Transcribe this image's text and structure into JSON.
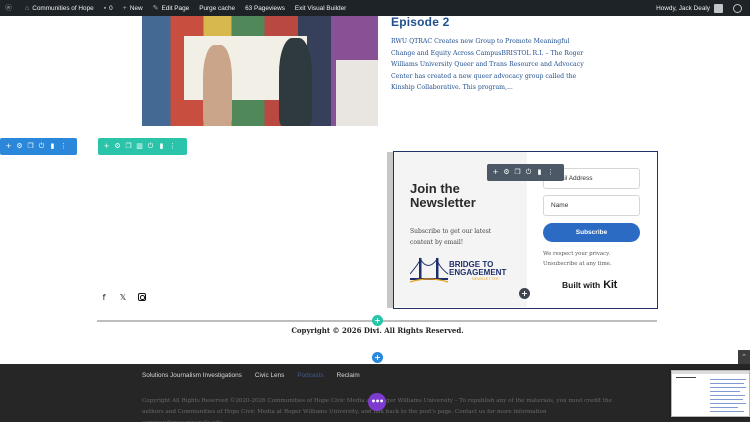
{
  "admin_bar": {
    "wp_logo": "wordpress-icon",
    "site_name": "Communities of Hope",
    "comments_count": "0",
    "new_label": "New",
    "edit_page_label": "Edit Page",
    "purge_cache_label": "Purge cache",
    "pageviews_label": "63 Pageviews",
    "exit_builder_label": "Exit Visual Builder",
    "howdy_label": "Howdy, Jack Dealy"
  },
  "episode": {
    "title": "Episode 2",
    "excerpt": "RWU QTRAC Creates new Group to Promote Meaningful Change and Equity Across CampusBRISTOL R.I. – The Roger Williams University Queer and Trans Resource and Advocacy Center has created a new queer advocacy group called the Kinship Collaborative.  This program,..."
  },
  "toolbars": {
    "row_icons": [
      "add-icon",
      "gear-icon",
      "duplicate-icon",
      "power-icon",
      "trash-icon",
      "more-icon"
    ],
    "section_icons": [
      "add-icon",
      "gear-icon",
      "duplicate-icon",
      "columns-icon",
      "power-icon",
      "trash-icon",
      "more-icon"
    ],
    "module_icons": [
      "add-icon",
      "gear-icon",
      "duplicate-icon",
      "power-icon",
      "trash-icon",
      "more-icon"
    ],
    "colors": {
      "row": "#2b87da",
      "section": "#29c4a9",
      "module": "#4c5866"
    }
  },
  "newsletter": {
    "title": "Join the Newsletter",
    "text": "Subscribe to get our latest content by email!",
    "logo_text_line1": "BRIDGE TO",
    "logo_text_line2": "ENGAGEMENT",
    "logo_sub": "NEWSLETTER",
    "email_placeholder": "Email Address",
    "name_placeholder": "Name",
    "subscribe_label": "Subscribe",
    "privacy": "We respect your privacy. Unsubscribe at any time.",
    "built_with": "Built with",
    "kit_label": "Kit",
    "accent": "#2b6bc4",
    "border": "#22306a"
  },
  "social": [
    "facebook-icon",
    "x-twitter-icon",
    "instagram-icon"
  ],
  "copyright": "Copyright © 2026 Divi. All Rights Reserved.",
  "footer": {
    "nav": [
      "Solutions Journalism Investigations",
      "Civic Lens",
      "Podcasts",
      "Reclaim"
    ],
    "text": "Copyright All Rights Reserved ©2020-2026 Communities of Hope Civic Media and Roger Williams University – To republish any of the materials, you must credit the authors and Communities of Hope Civic Media at Roger Williams University, and link back to the post's page. Contact us for more information commun@rwuuniversity.edu ."
  }
}
